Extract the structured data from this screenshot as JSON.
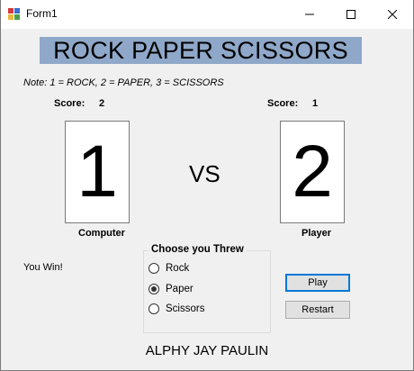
{
  "window": {
    "title": "Form1",
    "icon": "winforms-app-icon",
    "controls": [
      "minimize-icon",
      "maximize-icon",
      "close-icon"
    ]
  },
  "header": {
    "title": "ROCK PAPER SCISSORS"
  },
  "note": "Note: 1 = ROCK, 2 = PAPER, 3 = SCISSORS",
  "computer": {
    "score_label": "Score:",
    "score": "2",
    "choice": "1",
    "caption": "Computer"
  },
  "player": {
    "score_label": "Score:",
    "score": "1",
    "choice": "2",
    "caption": "Player"
  },
  "vs_label": "VS",
  "result": "You Win!",
  "choices": {
    "title": "Choose you Threw",
    "options": [
      {
        "label": "Rock",
        "checked": false
      },
      {
        "label": "Paper",
        "checked": true
      },
      {
        "label": "Scissors",
        "checked": false
      }
    ]
  },
  "buttons": {
    "play": "Play",
    "restart": "Restart"
  },
  "footer": "ALPHY JAY PAULIN",
  "colors": {
    "banner": "#8fa8c9",
    "focus": "#0078d7",
    "background": "#f0f0f0"
  }
}
